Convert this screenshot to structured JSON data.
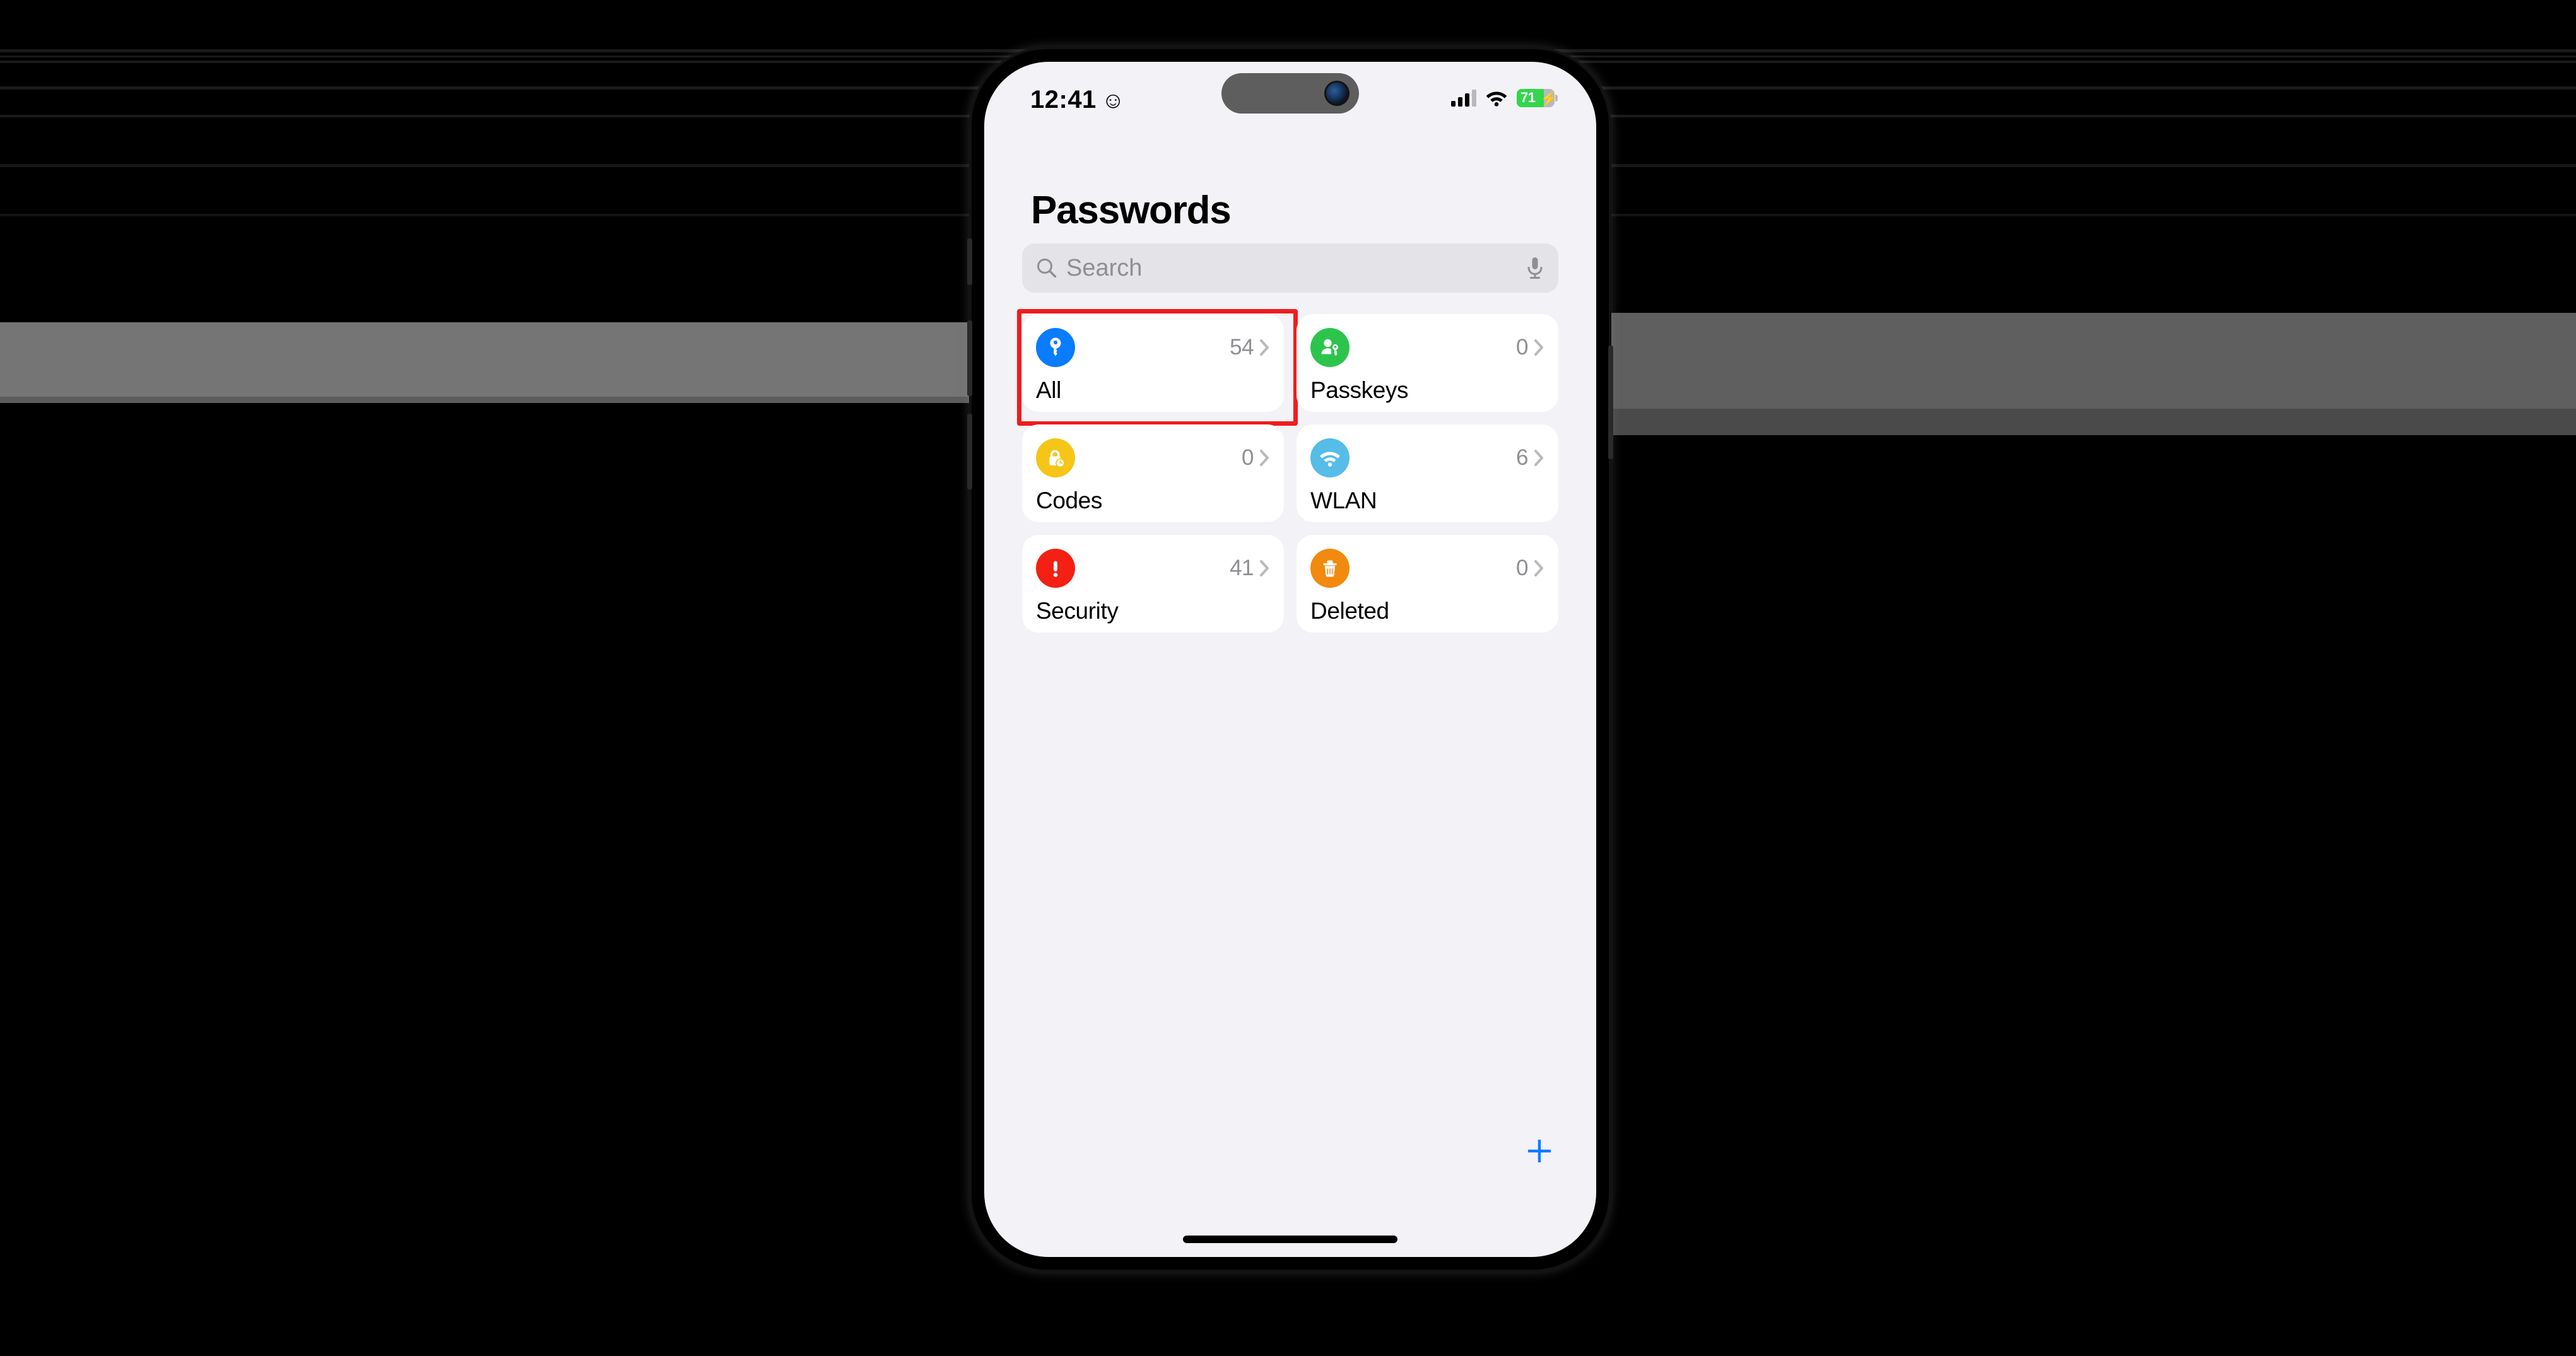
{
  "status_bar": {
    "time": "12:41",
    "emoji": "☺",
    "emoji_name": "smiley-face",
    "signal_bars_filled": 3,
    "signal_bars_total": 4,
    "wifi": "wifi-icon",
    "battery_percent": "71",
    "battery_charging": true,
    "battery_bolt": "⚡",
    "battery_color": "#32D74B"
  },
  "header": {
    "title": "Passwords"
  },
  "search": {
    "placeholder": "Search",
    "value": "",
    "search_icon": "magnifier-icon",
    "mic_icon": "microphone-icon"
  },
  "cards": [
    {
      "label": "All",
      "count": "54",
      "icon": "key-icon",
      "color": "#0A7CFF",
      "highlighted": true
    },
    {
      "label": "Passkeys",
      "count": "0",
      "icon": "person-key-icon",
      "color": "#2DC44D",
      "highlighted": false
    },
    {
      "label": "Codes",
      "count": "0",
      "icon": "lock-clock-icon",
      "color": "#F5C518",
      "highlighted": false
    },
    {
      "label": "WLAN",
      "count": "6",
      "icon": "wifi-icon",
      "color": "#56BCE8",
      "highlighted": false
    },
    {
      "label": "Security",
      "count": "41",
      "icon": "warning-icon",
      "color": "#F32013",
      "highlighted": false
    },
    {
      "label": "Deleted",
      "count": "0",
      "icon": "trash-icon",
      "color": "#F28A0F",
      "highlighted": false
    }
  ],
  "add_button": {
    "icon": "plus-icon",
    "label": "+",
    "color": "#0A7CFF"
  },
  "home_indicator": "home-indicator",
  "highlight": {
    "color": "#F01C1C",
    "target": "All"
  }
}
